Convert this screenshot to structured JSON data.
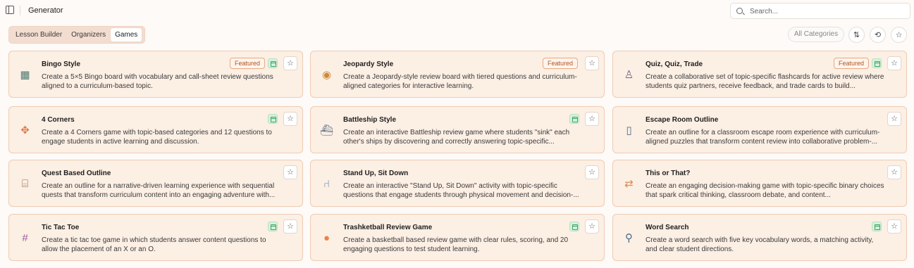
{
  "header": {
    "title": "Generator",
    "search_placeholder": "Search..."
  },
  "tabs": [
    {
      "label": "Lesson Builder",
      "active": false
    },
    {
      "label": "Organizers",
      "active": false
    },
    {
      "label": "Games",
      "active": true
    }
  ],
  "toolbar": {
    "category_filter": "All Categories",
    "sort_icon": "sort-icon",
    "history_icon": "history-icon",
    "favorites_icon": "star-icon"
  },
  "featured_label": "Featured",
  "colors": {
    "card_bg": "#fcefe4",
    "card_border": "#f0cbb3",
    "featured_text": "#b7531e",
    "badge_green": "#3aa35e"
  },
  "cards": [
    {
      "title": "Bingo Style",
      "desc": "Create a 5×5 Bingo board with vocabulary and call-sheet review questions aligned to a curriculum-based topic.",
      "icon": "bingo-card-icon",
      "featured": true,
      "doc_badge": true
    },
    {
      "title": "Jeopardy Style",
      "desc": "Create a Jeopardy-style review board with tiered questions and curriculum-aligned categories for interactive learning.",
      "icon": "game-show-icon",
      "featured": true,
      "doc_badge": false
    },
    {
      "title": "Quiz, Quiz, Trade",
      "desc": "Create a collaborative set of topic-specific flashcards for active review where students quiz partners, receive feedback, and trade cards to build...",
      "icon": "students-trade-icon",
      "featured": true,
      "doc_badge": true
    },
    {
      "title": "4 Corners",
      "desc": "Create a 4 Corners game with topic-based categories and 12 questions to engage students in active learning and discussion.",
      "icon": "four-corners-icon",
      "featured": false,
      "doc_badge": true
    },
    {
      "title": "Battleship Style",
      "desc": "Create an interactive Battleship review game where students \"sink\" each other's ships by discovering and correctly answering topic-specific...",
      "icon": "battleship-icon",
      "featured": false,
      "doc_badge": true
    },
    {
      "title": "Escape Room Outline",
      "desc": "Create an outline for a classroom escape room experience with curriculum-aligned puzzles that transform content review into collaborative problem-...",
      "icon": "door-icon",
      "featured": false,
      "doc_badge": false
    },
    {
      "title": "Quest Based Outline",
      "desc": "Create an outline for a narrative-driven learning experience with sequential quests that transform curriculum content into an engaging adventure with...",
      "icon": "treasure-chest-icon",
      "featured": false,
      "doc_badge": false
    },
    {
      "title": "Stand Up, Sit Down",
      "desc": "Create an interactive \"Stand Up, Sit Down\" activity with topic-specific questions that engage students through physical movement and decision-...",
      "icon": "chair-icon",
      "featured": false,
      "doc_badge": false
    },
    {
      "title": "This or That?",
      "desc": "Create an engaging decision-making game with topic-specific binary choices that spark critical thinking, classroom debate, and content...",
      "icon": "swap-arrows-icon",
      "featured": false,
      "doc_badge": false
    },
    {
      "title": "Tic Tac Toe",
      "desc": "Create a tic tac toe game in which students answer content questions to allow the placement of an X or an O.",
      "icon": "tic-tac-toe-icon",
      "featured": false,
      "doc_badge": true
    },
    {
      "title": "Trashketball Review Game",
      "desc": "Create a basketball based review game with clear rules, scoring, and 20 engaging questions to test student learning.",
      "icon": "basketball-icon",
      "featured": false,
      "doc_badge": true
    },
    {
      "title": "Word Search",
      "desc": "Create a word search with five key vocabulary words, a matching activity, and clear student directions.",
      "icon": "magnifier-icon",
      "featured": false,
      "doc_badge": true
    }
  ]
}
